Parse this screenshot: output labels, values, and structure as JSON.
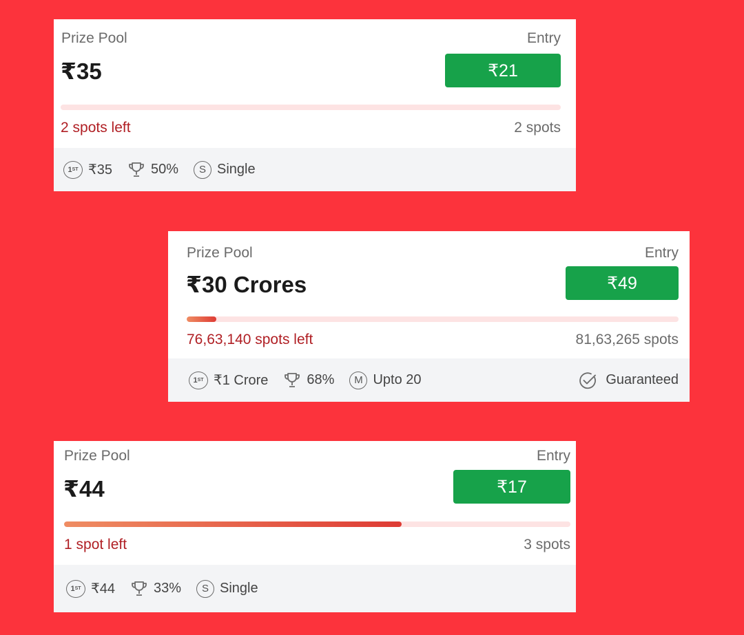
{
  "colors": {
    "background": "#fc333c",
    "entry_button": "#17a24a",
    "spots_left_text": "#b01f24",
    "progress_track": "#fde3e3",
    "progress_fill_start": "#ef8d63",
    "progress_fill_end": "#de3b34"
  },
  "contests": [
    {
      "prize_pool_label": "Prize Pool",
      "prize_pool": "₹35",
      "entry_label": "Entry",
      "entry_fee": "₹21",
      "filled_percent": 0,
      "spots_left": "2 spots left",
      "total_spots": "2 spots",
      "first_icon": "first-place-icon",
      "first_prize": "₹35",
      "trophy_icon": "trophy-icon",
      "win_percent": "50%",
      "entry_type_icon": "single-entry-icon",
      "entry_type_letter": "S",
      "entry_type": "Single"
    },
    {
      "prize_pool_label": "Prize Pool",
      "prize_pool": "₹30 Crores",
      "entry_label": "Entry",
      "entry_fee": "₹49",
      "filled_percent": 6,
      "spots_left": "76,63,140 spots left",
      "total_spots": "81,63,265 spots",
      "first_icon": "first-place-icon",
      "first_prize": "₹1 Crore",
      "trophy_icon": "trophy-icon",
      "win_percent": "68%",
      "entry_type_icon": "multi-entry-icon",
      "entry_type_letter": "M",
      "entry_type": "Upto 20",
      "guaranteed_icon": "check-circle-icon",
      "guaranteed": "Guaranteed"
    },
    {
      "prize_pool_label": "Prize Pool",
      "prize_pool": "₹44",
      "entry_label": "Entry",
      "entry_fee": "₹17",
      "filled_percent": 66.7,
      "spots_left": "1 spot left",
      "total_spots": "3 spots",
      "first_icon": "first-place-icon",
      "first_prize": "₹44",
      "trophy_icon": "trophy-icon",
      "win_percent": "33%",
      "entry_type_icon": "single-entry-icon",
      "entry_type_letter": "S",
      "entry_type": "Single"
    }
  ]
}
